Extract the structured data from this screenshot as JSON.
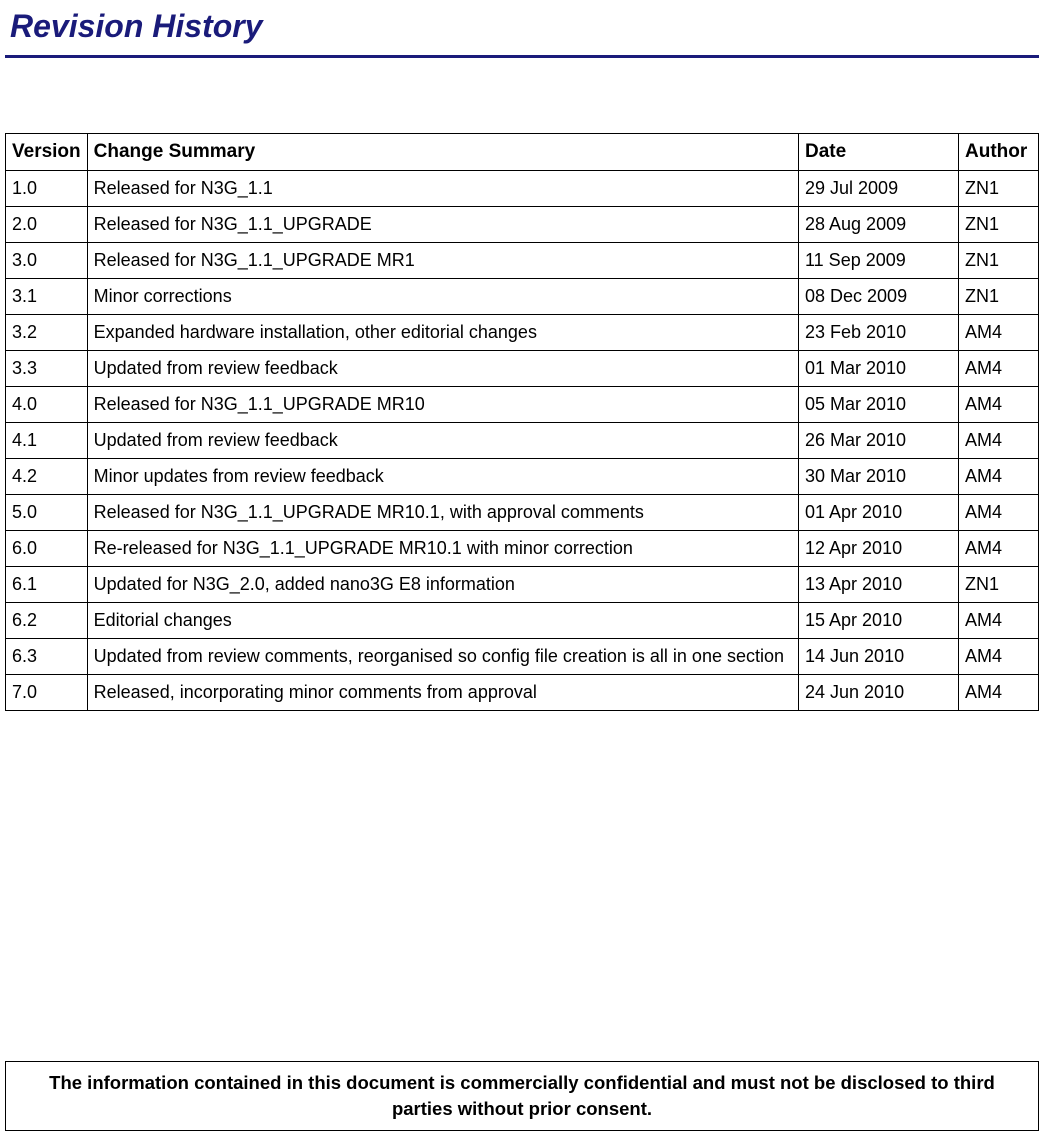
{
  "title": "Revision History",
  "table": {
    "headers": {
      "version": "Version",
      "summary": "Change Summary",
      "date": "Date",
      "author": "Author"
    },
    "rows": [
      {
        "version": "1.0",
        "summary": "Released for N3G_1.1",
        "date": "29 Jul 2009",
        "author": "ZN1"
      },
      {
        "version": "2.0",
        "summary": "Released for N3G_1.1_UPGRADE",
        "date": "28 Aug 2009",
        "author": "ZN1"
      },
      {
        "version": "3.0",
        "summary": "Released for N3G_1.1_UPGRADE MR1",
        "date": "11 Sep 2009",
        "author": "ZN1"
      },
      {
        "version": "3.1",
        "summary": "Minor corrections",
        "date": "08 Dec 2009",
        "author": "ZN1"
      },
      {
        "version": "3.2",
        "summary": "Expanded hardware installation, other editorial changes",
        "date": "23 Feb 2010",
        "author": "AM4"
      },
      {
        "version": "3.3",
        "summary": "Updated from review feedback",
        "date": "01 Mar 2010",
        "author": "AM4"
      },
      {
        "version": "4.0",
        "summary": "Released for N3G_1.1_UPGRADE MR10",
        "date": "05 Mar 2010",
        "author": "AM4"
      },
      {
        "version": "4.1",
        "summary": "Updated from review feedback",
        "date": "26 Mar 2010",
        "author": "AM4"
      },
      {
        "version": "4.2",
        "summary": "Minor updates from review feedback",
        "date": "30 Mar 2010",
        "author": "AM4"
      },
      {
        "version": "5.0",
        "summary": "Released for N3G_1.1_UPGRADE MR10.1, with approval comments",
        "date": "01 Apr 2010",
        "author": "AM4"
      },
      {
        "version": "6.0",
        "summary": "Re-released for N3G_1.1_UPGRADE MR10.1 with minor correction",
        "date": "12 Apr 2010",
        "author": "AM4"
      },
      {
        "version": "6.1",
        "summary": "Updated for N3G_2.0, added nano3G E8 information",
        "date": "13 Apr 2010",
        "author": "ZN1"
      },
      {
        "version": "6.2",
        "summary": "Editorial changes",
        "date": "15 Apr 2010",
        "author": "AM4"
      },
      {
        "version": "6.3",
        "summary": "Updated from review comments, reorganised so config file creation is all in one section",
        "date": "14 Jun 2010",
        "author": "AM4"
      },
      {
        "version": "7.0",
        "summary": "Released, incorporating minor comments from approval",
        "date": "24 Jun 2010",
        "author": "AM4"
      }
    ]
  },
  "footer": "The information contained in this document is commercially confidential and must not be disclosed to third parties without prior consent."
}
